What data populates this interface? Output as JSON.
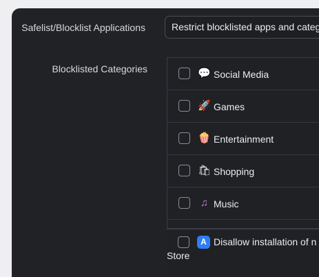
{
  "safelist": {
    "label": "Safelist/Blocklist Applications",
    "select_value": "Restrict blocklisted apps and catego"
  },
  "blocklisted": {
    "label": "Blocklisted Categories",
    "items": [
      {
        "label": "Social Media",
        "icon": "💬",
        "icon_name": "social-media-icon"
      },
      {
        "label": "Games",
        "icon": "🚀",
        "icon_name": "rocket-icon"
      },
      {
        "label": "Entertainment",
        "icon": "🍿",
        "icon_name": "popcorn-icon"
      },
      {
        "label": "Shopping",
        "icon": "🛍",
        "icon_name": "shopping-bag-icon"
      },
      {
        "label": "Music",
        "icon": "♫",
        "icon_name": "music-notes-icon"
      }
    ],
    "app_store_item": {
      "label": "Disallow installation of n App Store",
      "icon": "A",
      "icon_name": "app-store-icon"
    }
  }
}
